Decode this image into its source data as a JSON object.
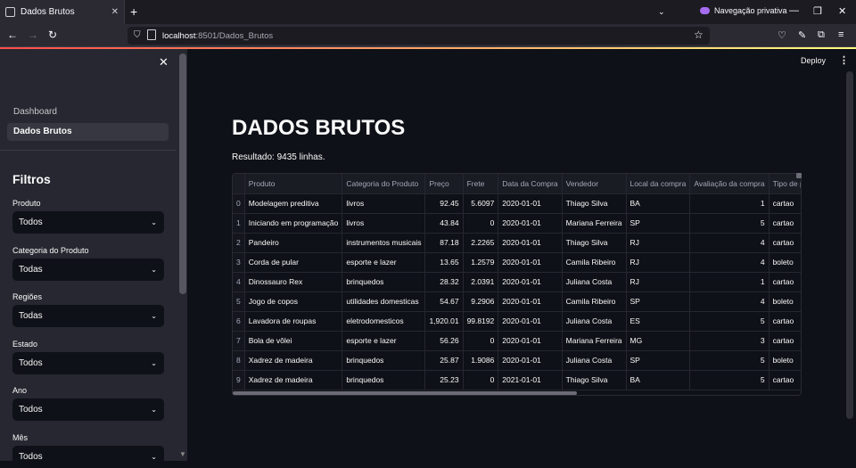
{
  "browser": {
    "tab_title": "Dados Brutos",
    "private_label": "Navegação privativa",
    "url_host": "localhost",
    "url_rest": ":8501/Dados_Brutos"
  },
  "app": {
    "deploy_label": "Deploy",
    "menu_icon": "⋮"
  },
  "sidebar": {
    "nav": [
      {
        "label": "Dashboard",
        "active": false
      },
      {
        "label": "Dados Brutos",
        "active": true
      }
    ],
    "filters_title": "Filtros",
    "filters": [
      {
        "label": "Produto",
        "value": "Todos"
      },
      {
        "label": "Categoria do Produto",
        "value": "Todas"
      },
      {
        "label": "Regiões",
        "value": "Todas"
      },
      {
        "label": "Estado",
        "value": "Todos"
      },
      {
        "label": "Ano",
        "value": "Todos"
      },
      {
        "label": "Mês",
        "value": "Todos"
      }
    ]
  },
  "main": {
    "title": "DADOS BRUTOS",
    "result_text": "Resultado: 9435 linhas."
  },
  "table": {
    "columns": [
      "",
      "Produto",
      "Categoria do Produto",
      "Preço",
      "Frete",
      "Data da Compra",
      "Vendedor",
      "Local da compra",
      "Avaliação da compra",
      "Tipo de pagamento"
    ],
    "rows": [
      [
        "0",
        "Modelagem preditiva",
        "livros",
        "92.45",
        "5.6097",
        "2020-01-01",
        "Thiago Silva",
        "BA",
        "1",
        "cartao"
      ],
      [
        "1",
        "Iniciando em programação",
        "livros",
        "43.84",
        "0",
        "2020-01-01",
        "Mariana Ferreira",
        "SP",
        "5",
        "cartao"
      ],
      [
        "2",
        "Pandeiro",
        "instrumentos musicais",
        "87.18",
        "2.2265",
        "2020-01-01",
        "Thiago Silva",
        "RJ",
        "4",
        "cartao"
      ],
      [
        "3",
        "Corda de pular",
        "esporte e lazer",
        "13.65",
        "1.2579",
        "2020-01-01",
        "Camila Ribeiro",
        "RJ",
        "4",
        "boleto"
      ],
      [
        "4",
        "Dinossauro Rex",
        "brinquedos",
        "28.32",
        "2.0391",
        "2020-01-01",
        "Juliana Costa",
        "RJ",
        "1",
        "cartao"
      ],
      [
        "5",
        "Jogo de copos",
        "utilidades domesticas",
        "54.67",
        "9.2906",
        "2020-01-01",
        "Camila Ribeiro",
        "SP",
        "4",
        "boleto"
      ],
      [
        "6",
        "Lavadora de roupas",
        "eletrodomesticos",
        "1,920.01",
        "99.8192",
        "2020-01-01",
        "Juliana Costa",
        "ES",
        "5",
        "cartao"
      ],
      [
        "7",
        "Bola de vôlei",
        "esporte e lazer",
        "56.26",
        "0",
        "2020-01-01",
        "Mariana Ferreira",
        "MG",
        "3",
        "cartao"
      ],
      [
        "8",
        "Xadrez de madeira",
        "brinquedos",
        "25.87",
        "1.9086",
        "2020-01-01",
        "Juliana Costa",
        "SP",
        "5",
        "boleto"
      ],
      [
        "9",
        "Xadrez de madeira",
        "brinquedos",
        "25.23",
        "0",
        "2021-01-01",
        "Thiago Silva",
        "BA",
        "5",
        "cartao"
      ]
    ]
  }
}
